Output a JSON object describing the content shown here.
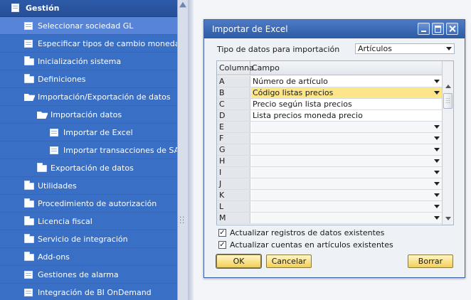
{
  "nav": {
    "header": "Gestión",
    "items": [
      {
        "label": "Seleccionar sociedad GL",
        "icon": "page-icon",
        "indent": 0,
        "selected": true
      },
      {
        "label": "Especificar tipos de cambio moneda extra",
        "icon": "page-icon",
        "indent": 0,
        "selected": false
      },
      {
        "label": "Inicialización sistema",
        "icon": "folder-icon",
        "indent": 0,
        "selected": false
      },
      {
        "label": "Definiciones",
        "icon": "folder-icon",
        "indent": 0,
        "selected": false
      },
      {
        "label": "Importación/Exportación de datos",
        "icon": "folder-open-icon",
        "indent": 0,
        "selected": false
      },
      {
        "label": "Importación datos",
        "icon": "folder-open-icon",
        "indent": 1,
        "selected": false
      },
      {
        "label": "Importar de Excel",
        "icon": "page-icon",
        "indent": 2,
        "selected": false
      },
      {
        "label": "Importar transacciones de SAP Bu",
        "icon": "page-icon",
        "indent": 2,
        "selected": false
      },
      {
        "label": "Exportación de datos",
        "icon": "folder-icon",
        "indent": 1,
        "selected": false
      },
      {
        "label": "Utilidades",
        "icon": "folder-icon",
        "indent": 0,
        "selected": false
      },
      {
        "label": "Procedimiento de autorización",
        "icon": "folder-icon",
        "indent": 0,
        "selected": false
      },
      {
        "label": "Licencia fiscal",
        "icon": "folder-icon",
        "indent": 0,
        "selected": false
      },
      {
        "label": "Servicio de integración",
        "icon": "folder-icon",
        "indent": 0,
        "selected": false
      },
      {
        "label": "Add-ons",
        "icon": "folder-icon",
        "indent": 0,
        "selected": false
      },
      {
        "label": "Gestiones de alarma",
        "icon": "page-icon",
        "indent": 0,
        "selected": false
      },
      {
        "label": "Integración de BI OnDemand",
        "icon": "page-icon",
        "indent": 0,
        "selected": false
      }
    ]
  },
  "dialog": {
    "title": "Importar de Excel",
    "type_label": "Tipo de datos para importación",
    "type_value": "Artículos",
    "grid": {
      "col_header": "Columna",
      "field_header": "Campo",
      "rows": [
        {
          "key": "A",
          "field": "Número de artículo",
          "dropdown": true,
          "highlight": false
        },
        {
          "key": "B",
          "field": "Código listas precios",
          "dropdown": true,
          "highlight": true
        },
        {
          "key": "C",
          "field": "Precio según lista precios",
          "dropdown": false,
          "highlight": false
        },
        {
          "key": "D",
          "field": "Lista precios moneda precio",
          "dropdown": false,
          "highlight": false
        },
        {
          "key": "E",
          "field": "",
          "dropdown": true,
          "highlight": false
        },
        {
          "key": "F",
          "field": "",
          "dropdown": true,
          "highlight": false
        },
        {
          "key": "G",
          "field": "",
          "dropdown": true,
          "highlight": false
        },
        {
          "key": "H",
          "field": "",
          "dropdown": true,
          "highlight": false
        },
        {
          "key": "I",
          "field": "",
          "dropdown": true,
          "highlight": false
        },
        {
          "key": "J",
          "field": "",
          "dropdown": true,
          "highlight": false
        },
        {
          "key": "K",
          "field": "",
          "dropdown": true,
          "highlight": false
        },
        {
          "key": "L",
          "field": "",
          "dropdown": true,
          "highlight": false
        },
        {
          "key": "M",
          "field": "",
          "dropdown": true,
          "highlight": false
        }
      ]
    },
    "checkboxes": [
      {
        "label": "Actualizar registros de datos existentes",
        "checked": true
      },
      {
        "label": "Actualizar cuentas en artículos existentes",
        "checked": true
      }
    ],
    "buttons": {
      "ok": "OK",
      "cancel": "Cancelar",
      "delete": "Borrar"
    },
    "check_glyph": "✓"
  },
  "colors": {
    "nav_bg": "#3a6fc6",
    "selected_bg": "#5784d6",
    "highlight": "#fde58a",
    "button": "#f3cf55"
  }
}
